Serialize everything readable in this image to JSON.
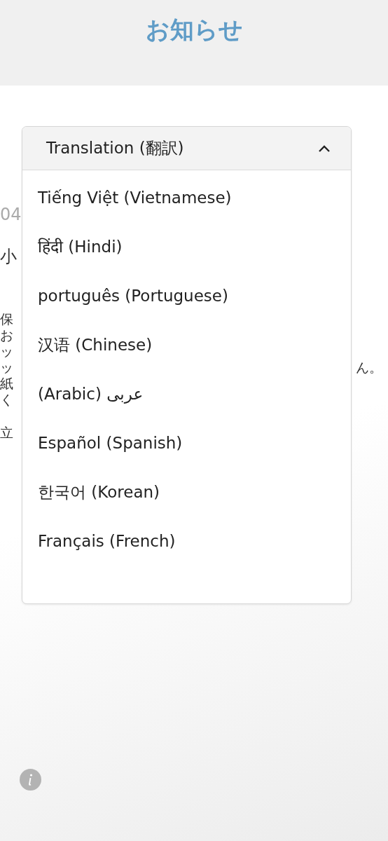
{
  "header": {
    "title": "お知らせ"
  },
  "article": {
    "date": "04",
    "heading": "小",
    "lines": [
      {
        "left": "保"
      },
      {
        "left": "お"
      },
      {
        "left": "ッ"
      },
      {
        "left": "ッ",
        "right": "ん。"
      },
      {
        "left": "紙"
      },
      {
        "left": "く"
      }
    ],
    "note": "立"
  },
  "translation_menu": {
    "label": "Translation (翻訳)",
    "expanded": true,
    "options": [
      "Tiếng Việt (Vietnamese)",
      "हिंदी (Hindi)",
      "português (Portuguese)",
      "汉语 (Chinese)",
      "(Arabic) عربى",
      "Español (Spanish)",
      "한국어 (Korean)",
      "Français (French)"
    ]
  }
}
